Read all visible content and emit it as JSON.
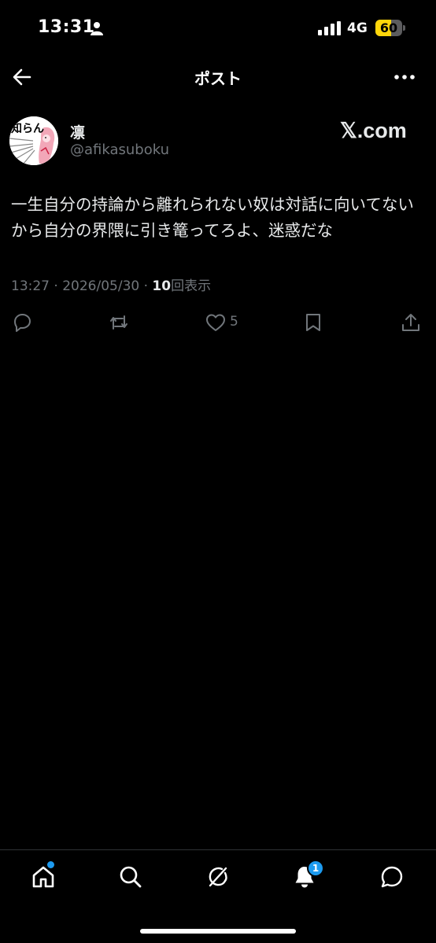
{
  "status_bar": {
    "time": "13:31",
    "network": "4G",
    "battery_level": "60",
    "battery_fraction": 0.6,
    "battery_color": "#ffd60a"
  },
  "header": {
    "title": "ポスト",
    "back_icon": "arrow-left-icon",
    "more_icon": "more-horizontal-icon"
  },
  "post": {
    "author_name": "凛",
    "author_handle": "@afikasuboku",
    "avatar_text": "知らん",
    "brand": "𝕏.com",
    "text": "一生自分の持論から離れられない奴は対話に向いてないから自分の界隈に引き篭ってろよ、迷惑だな",
    "time": "13:27",
    "date": "2026/05/30",
    "separator": "·",
    "views_count": "10",
    "views_label": "回表示",
    "like_count": "5"
  },
  "actions": [
    "reply-icon",
    "repost-icon",
    "like-icon",
    "bookmark-icon",
    "share-icon"
  ],
  "tab_bar": {
    "tabs": [
      "home-icon",
      "search-icon",
      "grok-icon",
      "notifications-icon",
      "messages-icon"
    ],
    "notifications_badge": "1",
    "accent_color": "#1d9bf0"
  }
}
